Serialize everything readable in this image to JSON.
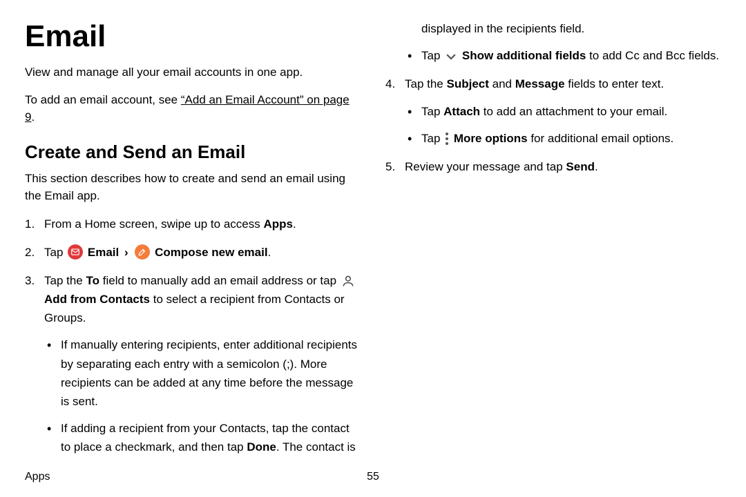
{
  "title": "Email",
  "intro1": "View and manage all your email accounts in one app.",
  "intro2_prefix": "To add an email account, see ",
  "intro2_link": "“Add an Email Account” on page 9",
  "intro2_suffix": ".",
  "section_heading": "Create and Send an Email",
  "section_desc": "This section describes how to create and send an email using the Email app.",
  "step1": {
    "prefix": "From a Home screen, swipe up to access ",
    "b1": "Apps",
    "suffix": "."
  },
  "step2": {
    "t1": "Tap ",
    "b1": "Email",
    "caret": "›",
    "b2": "Compose new email",
    "suffix": "."
  },
  "step3": {
    "t1": "Tap the ",
    "b1": "To",
    "t2": " field to manually add an email address or tap ",
    "b2": "Add from Contacts",
    "t3": " to select a recipient from Contacts or Groups.",
    "sub1": "If manually entering recipients, enter additional recipients by separating each entry with a semicolon (;). More recipients can be added at any time before the message is sent.",
    "sub2": {
      "t1": "If adding a recipient from your Contacts, tap the contact to place a checkmark, and then tap ",
      "b1": "Done",
      "t2": ". The contact is displayed in the recipients field."
    },
    "sub3": {
      "t1": "Tap ",
      "b1": "Show additional fields",
      "t2": " to add Cc and Bcc fields."
    }
  },
  "step4": {
    "t1": "Tap the ",
    "b1": "Subject",
    "t2": " and ",
    "b2": "Message",
    "t3": " fields to enter text.",
    "sub1": {
      "t1": "Tap ",
      "b1": "Attach",
      "t2": " to add an attachment to your email."
    },
    "sub2": {
      "t1": "Tap ",
      "b1": "More options",
      "t2": " for additional email options."
    }
  },
  "step5": {
    "t1": "Review your message and tap ",
    "b1": "Send",
    "suffix": "."
  },
  "footer_left": "Apps",
  "footer_page": "55"
}
